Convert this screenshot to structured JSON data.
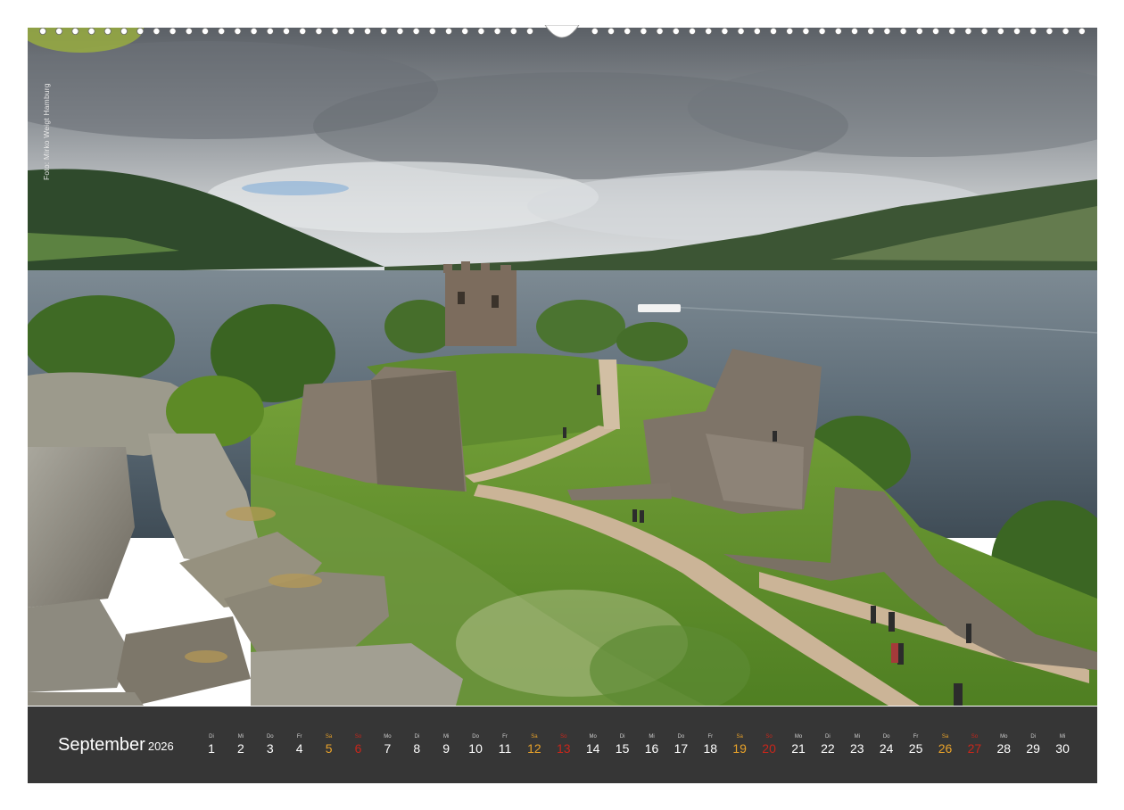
{
  "photo": {
    "subject": "Urquhart Castle ruins at Loch Ness",
    "credit": "Foto: Mirko Weigt Hamburg"
  },
  "calendar": {
    "month": "September",
    "year": "2026",
    "days": [
      {
        "dow": "Di",
        "num": "1",
        "kind": "weekday"
      },
      {
        "dow": "Mi",
        "num": "2",
        "kind": "weekday"
      },
      {
        "dow": "Do",
        "num": "3",
        "kind": "weekday"
      },
      {
        "dow": "Fr",
        "num": "4",
        "kind": "weekday"
      },
      {
        "dow": "Sa",
        "num": "5",
        "kind": "sat"
      },
      {
        "dow": "So",
        "num": "6",
        "kind": "sun"
      },
      {
        "dow": "Mo",
        "num": "7",
        "kind": "weekday"
      },
      {
        "dow": "Di",
        "num": "8",
        "kind": "weekday"
      },
      {
        "dow": "Mi",
        "num": "9",
        "kind": "weekday"
      },
      {
        "dow": "Do",
        "num": "10",
        "kind": "weekday"
      },
      {
        "dow": "Fr",
        "num": "11",
        "kind": "weekday"
      },
      {
        "dow": "Sa",
        "num": "12",
        "kind": "sat"
      },
      {
        "dow": "So",
        "num": "13",
        "kind": "sun"
      },
      {
        "dow": "Mo",
        "num": "14",
        "kind": "weekday"
      },
      {
        "dow": "Di",
        "num": "15",
        "kind": "weekday"
      },
      {
        "dow": "Mi",
        "num": "16",
        "kind": "weekday"
      },
      {
        "dow": "Do",
        "num": "17",
        "kind": "weekday"
      },
      {
        "dow": "Fr",
        "num": "18",
        "kind": "weekday"
      },
      {
        "dow": "Sa",
        "num": "19",
        "kind": "sat"
      },
      {
        "dow": "So",
        "num": "20",
        "kind": "sun"
      },
      {
        "dow": "Mo",
        "num": "21",
        "kind": "weekday"
      },
      {
        "dow": "Di",
        "num": "22",
        "kind": "weekday"
      },
      {
        "dow": "Mi",
        "num": "23",
        "kind": "weekday"
      },
      {
        "dow": "Do",
        "num": "24",
        "kind": "weekday"
      },
      {
        "dow": "Fr",
        "num": "25",
        "kind": "weekday"
      },
      {
        "dow": "Sa",
        "num": "26",
        "kind": "sat"
      },
      {
        "dow": "So",
        "num": "27",
        "kind": "sun"
      },
      {
        "dow": "Mo",
        "num": "28",
        "kind": "weekday"
      },
      {
        "dow": "Di",
        "num": "29",
        "kind": "weekday"
      },
      {
        "dow": "Mi",
        "num": "30",
        "kind": "weekday"
      }
    ]
  },
  "colors": {
    "footer_bg": "#363636",
    "saturday": "#e8a22a",
    "sunday": "#c8261b",
    "text": "#ffffff"
  }
}
